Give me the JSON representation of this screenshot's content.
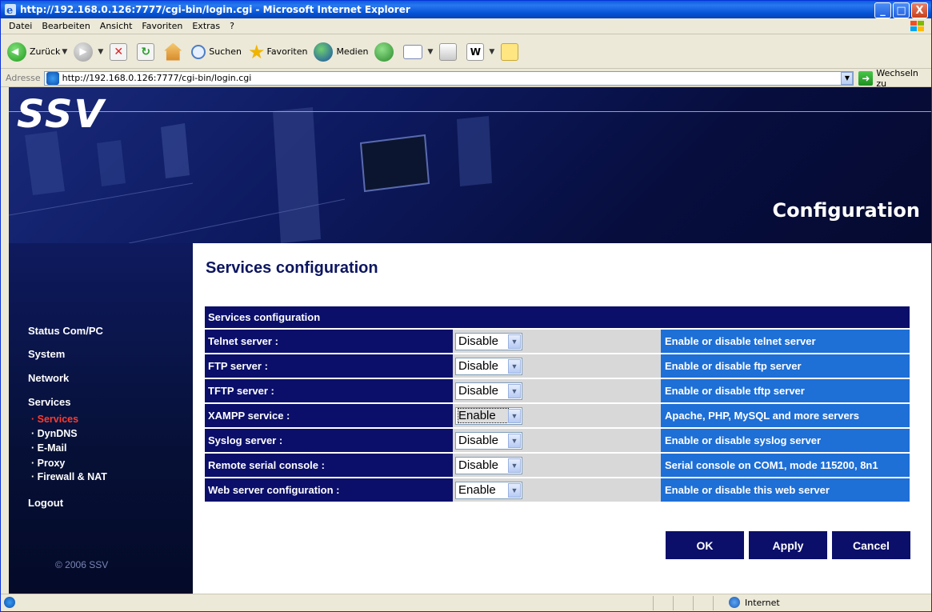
{
  "window": {
    "title": "http://192.168.0.126:7777/cgi-bin/login.cgi - Microsoft Internet Explorer",
    "minimize": "_",
    "maximize": "□",
    "close": "X"
  },
  "menubar": {
    "items": [
      "Datei",
      "Bearbeiten",
      "Ansicht",
      "Favoriten",
      "Extras",
      "?"
    ]
  },
  "toolbar": {
    "back_label": "Zurück",
    "search_label": "Suchen",
    "favorites_label": "Favoriten",
    "media_label": "Medien"
  },
  "addressbar": {
    "label": "Adresse",
    "url": "http://192.168.0.126:7777/cgi-bin/login.cgi",
    "go_label": "Wechseln zu"
  },
  "banner": {
    "logo": "SSV",
    "title": "Configuration"
  },
  "sidebar": {
    "status": "Status Com/PC",
    "system": "System",
    "network": "Network",
    "services": "Services",
    "sub_services": "· Services",
    "sub_dyndns": "· DynDNS",
    "sub_email": "· E-Mail",
    "sub_proxy": "· Proxy",
    "sub_firewall": "· Firewall & NAT",
    "logout": "Logout",
    "copyright": "© 2006 SSV"
  },
  "content": {
    "heading": "Services configuration",
    "table_header": "Services configuration",
    "rows": [
      {
        "label": "Telnet server :",
        "value": "Disable",
        "desc": "Enable or disable telnet server"
      },
      {
        "label": "FTP server :",
        "value": "Disable",
        "desc": "Enable or disable ftp server"
      },
      {
        "label": "TFTP server :",
        "value": "Disable",
        "desc": "Enable or disable tftp server"
      },
      {
        "label": "XAMPP service :",
        "value": "Enable",
        "desc": "Apache, PHP, MySQL and more servers"
      },
      {
        "label": "Syslog server :",
        "value": "Disable",
        "desc": "Enable or disable syslog server"
      },
      {
        "label": "Remote serial console :",
        "value": "Disable",
        "desc": "Serial console on COM1, mode 115200, 8n1"
      },
      {
        "label": "Web server configuration :",
        "value": "Enable",
        "desc": "Enable or disable this web server"
      }
    ],
    "buttons": {
      "ok": "OK",
      "apply": "Apply",
      "cancel": "Cancel"
    }
  },
  "statusbar": {
    "zone": "Internet"
  },
  "colors": {
    "navy": "#0b0f6a",
    "desc_blue": "#1e6fd6",
    "active_nav": "#ff3b2f"
  }
}
